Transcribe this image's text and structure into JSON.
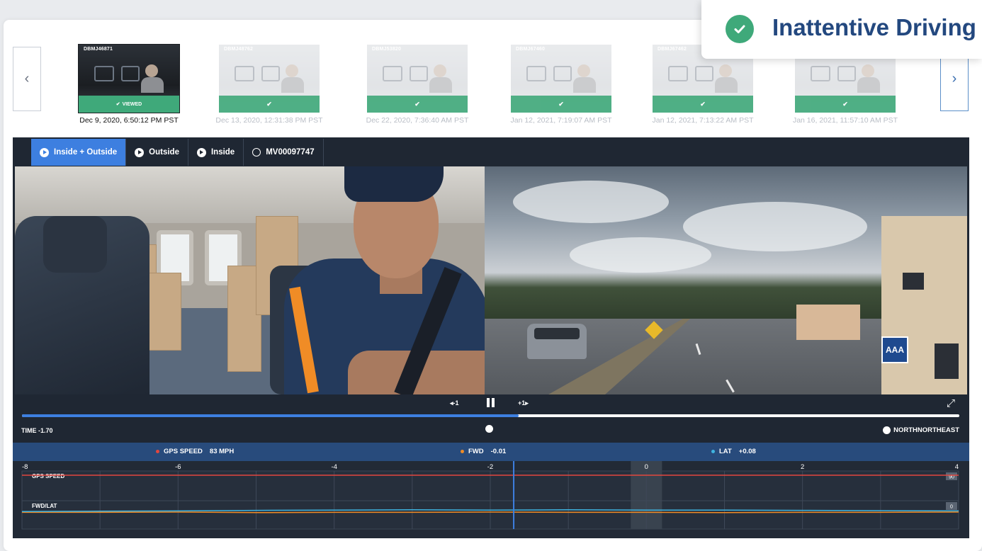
{
  "toast": {
    "title": "Inattentive Driving",
    "icon": "check-circle-icon",
    "color": "#3fa97a"
  },
  "thumbnails": [
    {
      "cam_id": "DBMJ46871",
      "badge": "VIEWED",
      "date": "Dec 9, 2020, 6:50:12 PM PST",
      "selected": true
    },
    {
      "cam_id": "DBMJ48762",
      "badge": "",
      "date": "Dec 13, 2020, 12:31:38 PM PST",
      "selected": false
    },
    {
      "cam_id": "DBMJ53820",
      "badge": "",
      "date": "Dec 22, 2020, 7:36:40 AM PST",
      "selected": false
    },
    {
      "cam_id": "DBMJ67460",
      "badge": "",
      "date": "Jan 12, 2021, 7:19:07 AM PST",
      "selected": false
    },
    {
      "cam_id": "DBMJ67462",
      "badge": "",
      "date": "Jan 12, 2021, 7:13:22 AM PST",
      "selected": false
    },
    {
      "cam_id": "",
      "badge": "",
      "date": "Jan 16, 2021, 11:57:10 AM PST",
      "selected": false
    }
  ],
  "nav": {
    "prev": "‹",
    "next": "›"
  },
  "tabs": [
    {
      "label": "Inside + Outside",
      "active": true,
      "icon": "play-circle-icon"
    },
    {
      "label": "Outside",
      "active": false,
      "icon": "play-circle-icon"
    },
    {
      "label": "Inside",
      "active": false,
      "icon": "play-circle-icon"
    },
    {
      "label": "MV00097747",
      "active": false,
      "icon": "circle-icon"
    }
  ],
  "controls": {
    "back": "◂-1",
    "forward": "+1▸",
    "progress_fraction": 0.53
  },
  "info": {
    "time": "TIME -1.70",
    "heading": "NORTHNORTHEAST"
  },
  "legend": {
    "gps": {
      "label": "GPS SPEED",
      "value": "83 MPH",
      "color": "#e2473f"
    },
    "fwd": {
      "label": "FWD",
      "value": "-0.01",
      "color": "#f08c26"
    },
    "lat": {
      "label": "LAT",
      "value": "+0.08",
      "color": "#3fb4e0"
    }
  },
  "chart_data": {
    "type": "line",
    "x_ticks": [
      "-8",
      "-6",
      "-4",
      "-2",
      "0",
      "2",
      "4"
    ],
    "xlim": [
      -8,
      4
    ],
    "cursor_x": -1.7,
    "highlight_x": [
      -0.2,
      0.2
    ],
    "panels": [
      {
        "label": "GPS SPEED",
        "max_label": "90",
        "series": [
          {
            "name": "GPS SPEED",
            "color": "#e2473f",
            "values": [
              83,
              83,
              83,
              83,
              83,
              83,
              83,
              83,
              83,
              83,
              83,
              83,
              83
            ]
          }
        ]
      },
      {
        "label": "FWD/LAT",
        "max_label": "0",
        "series": [
          {
            "name": "FWD",
            "color": "#f08c26",
            "values": [
              -0.01,
              -0.01,
              0.0,
              -0.02,
              -0.01,
              -0.01,
              0.0,
              -0.01,
              -0.01,
              -0.02,
              -0.01,
              -0.01,
              0.0
            ]
          },
          {
            "name": "LAT",
            "color": "#3fb4e0",
            "values": [
              0.02,
              0.03,
              0.04,
              0.06,
              0.07,
              0.08,
              0.07,
              0.08,
              0.07,
              0.07,
              0.06,
              0.05,
              0.04
            ]
          }
        ]
      }
    ],
    "grid": true
  }
}
